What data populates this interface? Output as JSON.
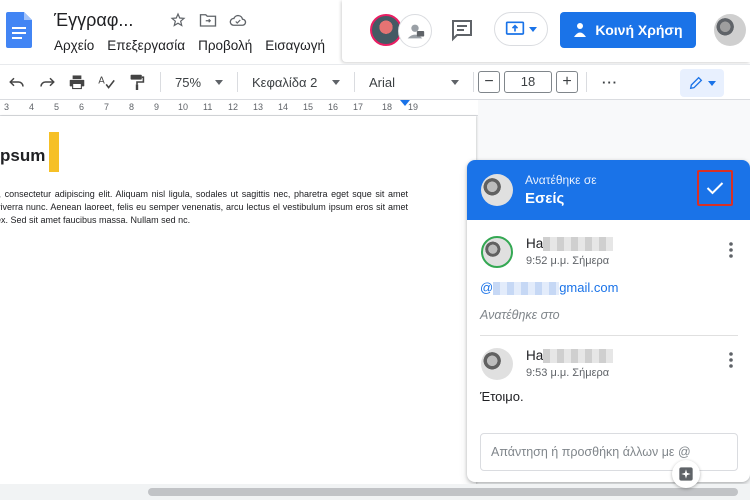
{
  "header": {
    "doc_title": "Έγγραφ...",
    "menu": [
      "Αρχείο",
      "Επεξεργασία",
      "Προβολή",
      "Εισαγωγή"
    ],
    "share_label": "Κοινή Χρήση"
  },
  "toolbar": {
    "zoom": "75%",
    "style": "Κεφαλίδα 2",
    "font": "Arial",
    "font_size": "18",
    "minus": "−",
    "plus": "+",
    "more": "···"
  },
  "ruler": {
    "ticks": [
      "3",
      "4",
      "5",
      "6",
      "7",
      "8",
      "9",
      "10",
      "11",
      "12",
      "13",
      "14",
      "15",
      "16",
      "17",
      "18",
      "19"
    ]
  },
  "document": {
    "heading": "psum",
    "body": "t, consectetur adipiscing elit. Aliquam nisl ligula, sodales ut sagittis  nec, pharetra eget sque sit amet viverra nunc. Aenean laoreet, felis eu semper  venenatis, arcu lectus el vestibulum ipsum eros sit amet ex. Sed sit amet faucibus  massa. Nullam sed nc."
  },
  "comment": {
    "assigned_label": "Ανατέθηκε σε",
    "assigned_to": "Εσείς",
    "first": {
      "name_prefix": "Ha",
      "time": "9:52 μ.μ. Σήμερα",
      "mention_prefix": "@",
      "mention_suffix": "gmail.com",
      "assigned_note": "Ανατέθηκε στο"
    },
    "second": {
      "name_prefix": "Ha",
      "time": "9:53 μ.μ. Σήμερα",
      "text": "Έτοιμο."
    },
    "reply_placeholder": "Απάντηση ή προσθήκη άλλων με @"
  },
  "colors": {
    "accent": "#1a73e8",
    "highlight": "#f6c026",
    "resolve_outline": "#d93025"
  }
}
